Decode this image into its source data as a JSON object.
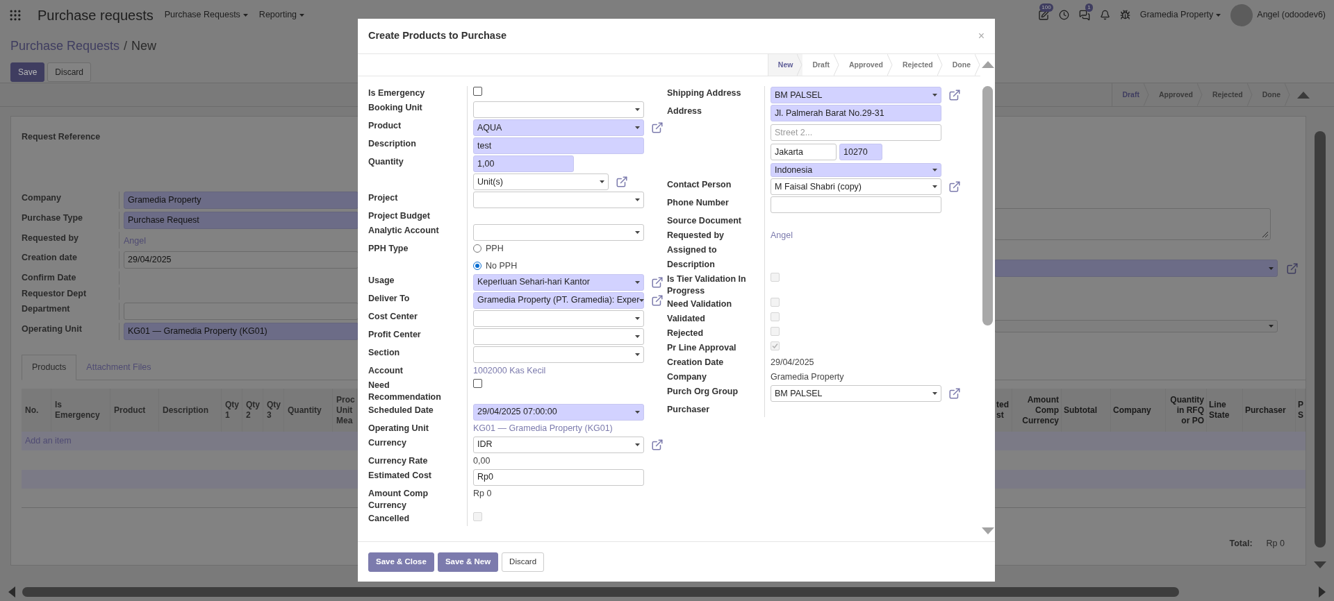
{
  "navbar": {
    "app_title": "Purchase requests",
    "menus": [
      "Purchase Requests",
      "Reporting"
    ],
    "activity_badge": "100",
    "message_badge": "1",
    "company": "Gramedia Property",
    "user": "Angel (odoodev6)"
  },
  "control_panel": {
    "breadcrumb": [
      {
        "label": "Purchase Requests",
        "kind": "link"
      },
      {
        "label": "New",
        "kind": "current"
      }
    ],
    "separator": "/",
    "buttons": [
      {
        "label": "Save",
        "kind": "primary"
      },
      {
        "label": "Discard",
        "kind": "secondary"
      }
    ]
  },
  "status_bar": [
    {
      "label": "Draft",
      "selected": true
    },
    {
      "label": "Approved",
      "selected": false
    },
    {
      "label": "Rejected",
      "selected": false
    },
    {
      "label": "Done",
      "selected": false
    }
  ],
  "form": {
    "title_label": "Request Reference",
    "fields": [
      {
        "label": "Company",
        "kind": "select",
        "value": "Gramedia Property",
        "required": true
      },
      {
        "label": "Purchase Type",
        "kind": "select",
        "value": "Purchase Request",
        "required": true
      },
      {
        "label": "Requested by",
        "kind": "link",
        "value": "Angel"
      },
      {
        "label": "Creation date",
        "kind": "input",
        "value": "29/04/2025",
        "required": false
      },
      {
        "label": "Confirm Date",
        "kind": "label_only"
      },
      {
        "label": "Requestor Dept",
        "kind": "label_only"
      },
      {
        "label": "Department",
        "kind": "input",
        "required": false
      },
      {
        "label": "Operating Unit",
        "kind": "select",
        "value": "KG01 — Gramedia Property (KG01)",
        "required": true
      }
    ],
    "right_widgets": [
      {
        "kind": "textarea"
      },
      {
        "kind": "select",
        "required": true,
        "link": true
      },
      {
        "kind": "select",
        "required": false,
        "link": false
      }
    ],
    "tabs": [
      {
        "label": "Products",
        "selected": true
      },
      {
        "label": "Attachment Files",
        "selected": false
      }
    ],
    "table": {
      "columns_left": [
        "No.",
        "Is Emergency",
        "Product",
        "Description",
        "Qty 1",
        "Qty 2",
        "Qty 3",
        "Quantity",
        "Proc Unit Mea"
      ],
      "columns_right": [
        "ted st",
        "Amount Comp Currency",
        "Subtotal",
        "Company",
        "Quantity in RFQ or PO",
        "Line State",
        "Purchaser",
        "P S"
      ],
      "add_item": "Add an item",
      "total_label": "Total:",
      "total_value": "Rp 0"
    }
  },
  "modal": {
    "title": "Create Products to Purchase",
    "close": "×",
    "status_bar": [
      {
        "label": "New",
        "selected": true
      },
      {
        "label": "Draft",
        "selected": false
      },
      {
        "label": "Approved",
        "selected": false
      },
      {
        "label": "Rejected",
        "selected": false
      },
      {
        "label": "Done",
        "selected": false
      }
    ],
    "left_fields": [
      {
        "label": "Is Emergency",
        "kind": "checkbox",
        "checked": false,
        "disabled": false
      },
      {
        "label": "Booking Unit",
        "kind": "select",
        "required": false,
        "link": false
      },
      {
        "label": "Product",
        "kind": "select",
        "value": "AQUA",
        "required": true,
        "link": true
      },
      {
        "label": "Description",
        "kind": "input",
        "value": "test",
        "required": true
      },
      {
        "label": "Quantity",
        "kind": "number_input",
        "value": "1,00",
        "required": true
      },
      {
        "kind": "unit_select",
        "value": "Unit(s)",
        "required": false,
        "link": true
      },
      {
        "label": "Project",
        "kind": "select",
        "required": false,
        "link": false
      },
      {
        "label": "Project Budget",
        "kind": "label_only"
      },
      {
        "label": "Analytic Account",
        "kind": "select",
        "required": false,
        "link": false
      },
      {
        "label": "PPH Type",
        "kind": "radio",
        "options": [
          {
            "label": "PPH",
            "selected": false
          },
          {
            "label": "No PPH",
            "selected": true
          }
        ]
      },
      {
        "label": "Usage",
        "kind": "select",
        "value": "Keperluan Sehari-hari Kantor",
        "required": true,
        "link": true
      },
      {
        "label": "Deliver To",
        "kind": "select",
        "value": "Gramedia Property (PT. Gramedia): Exper",
        "required": true,
        "link": true
      },
      {
        "label": "Cost Center",
        "kind": "select",
        "required": false,
        "link": false
      },
      {
        "label": "Profit Center",
        "kind": "select",
        "required": false,
        "link": false
      },
      {
        "label": "Section",
        "kind": "select",
        "required": false,
        "link": false
      },
      {
        "label": "Account",
        "kind": "link",
        "value": "1002000 Kas Kecil"
      },
      {
        "label": "Need Recommendation",
        "kind": "checkbox",
        "checked": false,
        "disabled": false
      },
      {
        "label": "Scheduled Date",
        "kind": "select",
        "value": "29/04/2025 07:00:00",
        "required": true,
        "link": false
      },
      {
        "label": "Operating Unit",
        "kind": "link",
        "value": "KG01 — Gramedia Property (KG01)"
      },
      {
        "label": "Currency",
        "kind": "select",
        "value": "IDR",
        "required": false,
        "link": true
      },
      {
        "label": "Currency Rate",
        "kind": "text",
        "value": "0,00"
      },
      {
        "label": "Estimated Cost",
        "kind": "input",
        "value": "Rp0",
        "required": false
      },
      {
        "label": "Amount Comp Currency",
        "kind": "text",
        "value": "Rp 0"
      },
      {
        "label": "Cancelled",
        "kind": "checkbox",
        "checked": false,
        "disabled": true
      }
    ],
    "right_fields": [
      {
        "label": "Shipping Address",
        "kind": "select",
        "value": "BM PALSEL",
        "required": true,
        "link": true
      },
      {
        "label": "Address",
        "kind": "address",
        "street": "Jl. Palmerah Barat No.29-31",
        "street2_placeholder": "Street 2...",
        "city": "Jakarta",
        "zip": "10270",
        "country": "Indonesia"
      },
      {
        "label": "Contact Person",
        "kind": "select",
        "value": "M Faisal Shabri (copy)",
        "required": false,
        "link": true
      },
      {
        "label": "Phone Number",
        "kind": "input",
        "required": false
      },
      {
        "label": "Source Document",
        "kind": "label_only"
      },
      {
        "label": "Requested by",
        "kind": "link",
        "value": "Angel"
      },
      {
        "label": "Assigned to",
        "kind": "label_only"
      },
      {
        "label": "Description",
        "kind": "label_only"
      },
      {
        "label": "Is Tier Validation In Progress",
        "kind": "checkbox",
        "checked": false,
        "disabled": true
      },
      {
        "label": "Need Validation",
        "kind": "checkbox",
        "checked": false,
        "disabled": true
      },
      {
        "label": "Validated",
        "kind": "checkbox",
        "checked": false,
        "disabled": true
      },
      {
        "label": "Rejected",
        "kind": "checkbox",
        "checked": false,
        "disabled": true
      },
      {
        "label": "Pr Line Approval",
        "kind": "checkbox",
        "checked": true,
        "disabled": true
      },
      {
        "label": "Creation Date",
        "kind": "text",
        "value": "29/04/2025"
      },
      {
        "label": "Company",
        "kind": "text",
        "value": "Gramedia Property"
      },
      {
        "label": "Purch Org Group",
        "kind": "select",
        "value": "BM PALSEL",
        "required": false,
        "link": true
      },
      {
        "label": "Purchaser",
        "kind": "label_only"
      }
    ],
    "buttons": [
      {
        "label": "Save & Close",
        "kind": "primary"
      },
      {
        "label": "Save & New",
        "kind": "primary"
      },
      {
        "label": "Discard",
        "kind": "secondary"
      }
    ]
  }
}
